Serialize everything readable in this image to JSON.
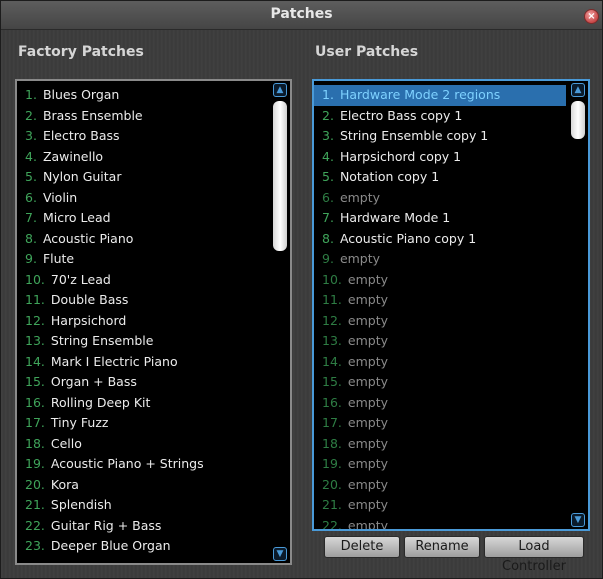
{
  "window": {
    "title": "Patches",
    "close_glyph": "×"
  },
  "factory": {
    "title": "Factory Patches",
    "items": [
      {
        "num": "1.",
        "label": "Blues Organ"
      },
      {
        "num": "2.",
        "label": "Brass Ensemble"
      },
      {
        "num": "3.",
        "label": "Electro Bass"
      },
      {
        "num": "4.",
        "label": "Zawinello"
      },
      {
        "num": "5.",
        "label": "Nylon Guitar"
      },
      {
        "num": "6.",
        "label": "Violin"
      },
      {
        "num": "7.",
        "label": "Micro Lead"
      },
      {
        "num": "8.",
        "label": "Acoustic Piano"
      },
      {
        "num": "9.",
        "label": "Flute"
      },
      {
        "num": "10.",
        "label": "70'z Lead"
      },
      {
        "num": "11.",
        "label": "Double Bass"
      },
      {
        "num": "12.",
        "label": "Harpsichord"
      },
      {
        "num": "13.",
        "label": "String Ensemble"
      },
      {
        "num": "14.",
        "label": "Mark I Electric Piano"
      },
      {
        "num": "15.",
        "label": "Organ + Bass"
      },
      {
        "num": "16.",
        "label": "Rolling Deep Kit"
      },
      {
        "num": "17.",
        "label": "Tiny Fuzz"
      },
      {
        "num": "18.",
        "label": "Cello"
      },
      {
        "num": "19.",
        "label": "Acoustic Piano + Strings"
      },
      {
        "num": "20.",
        "label": "Kora"
      },
      {
        "num": "21.",
        "label": "Splendish"
      },
      {
        "num": "22.",
        "label": "Guitar Rig + Bass"
      },
      {
        "num": "23.",
        "label": "Deeper Blue Organ"
      }
    ]
  },
  "user": {
    "title": "User Patches",
    "selected_index": 0,
    "items": [
      {
        "num": "1.",
        "label": "Hardware Mode 2 regions",
        "empty": false
      },
      {
        "num": "2.",
        "label": "Electro Bass copy 1",
        "empty": false
      },
      {
        "num": "3.",
        "label": "String Ensemble copy 1",
        "empty": false
      },
      {
        "num": "4.",
        "label": "Harpsichord copy 1",
        "empty": false
      },
      {
        "num": "5.",
        "label": "Notation copy 1",
        "empty": false
      },
      {
        "num": "6.",
        "label": "empty",
        "empty": true
      },
      {
        "num": "7.",
        "label": "Hardware Mode 1",
        "empty": false
      },
      {
        "num": "8.",
        "label": "Acoustic Piano copy 1",
        "empty": false
      },
      {
        "num": "9.",
        "label": "empty",
        "empty": true
      },
      {
        "num": "10.",
        "label": "empty",
        "empty": true
      },
      {
        "num": "11.",
        "label": "empty",
        "empty": true
      },
      {
        "num": "12.",
        "label": "empty",
        "empty": true
      },
      {
        "num": "13.",
        "label": "empty",
        "empty": true
      },
      {
        "num": "14.",
        "label": "empty",
        "empty": true
      },
      {
        "num": "15.",
        "label": "empty",
        "empty": true
      },
      {
        "num": "16.",
        "label": "empty",
        "empty": true
      },
      {
        "num": "17.",
        "label": "empty",
        "empty": true
      },
      {
        "num": "18.",
        "label": "empty",
        "empty": true
      },
      {
        "num": "19.",
        "label": "empty",
        "empty": true
      },
      {
        "num": "20.",
        "label": "empty",
        "empty": true
      },
      {
        "num": "21.",
        "label": "empty",
        "empty": true
      },
      {
        "num": "22.",
        "label": "empty",
        "empty": true
      }
    ]
  },
  "buttons": {
    "delete": "Delete",
    "rename": "Rename",
    "load_controller": "Load Controller"
  },
  "icons": {
    "scroll_up": "scroll-up-icon",
    "scroll_down": "scroll-down-icon",
    "close": "close-icon"
  }
}
